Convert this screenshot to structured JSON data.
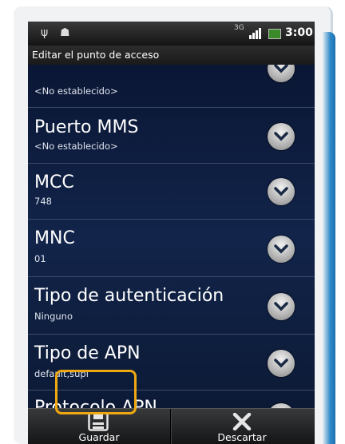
{
  "statusbar": {
    "usb_icon": "usb-icon",
    "android_icon": "android-icon",
    "network": "3G",
    "time": "3:00"
  },
  "title": "Editar el punto de acceso",
  "rows": [
    {
      "title": "",
      "subtitle": "<No establecido>"
    },
    {
      "title": "Puerto MMS",
      "subtitle": "<No establecido>"
    },
    {
      "title": "MCC",
      "subtitle": "748"
    },
    {
      "title": "MNC",
      "subtitle": "01"
    },
    {
      "title": "Tipo de autenticación",
      "subtitle": "Ninguno"
    },
    {
      "title": "Tipo de APN",
      "subtitle": "default,supl"
    },
    {
      "title": "Protocolo APN",
      "subtitle": ""
    }
  ],
  "bottombar": {
    "save_label": "Guardar",
    "discard_label": "Descartar"
  },
  "colors": {
    "highlight": "#f0a810",
    "list_bg": "#0b1933"
  }
}
